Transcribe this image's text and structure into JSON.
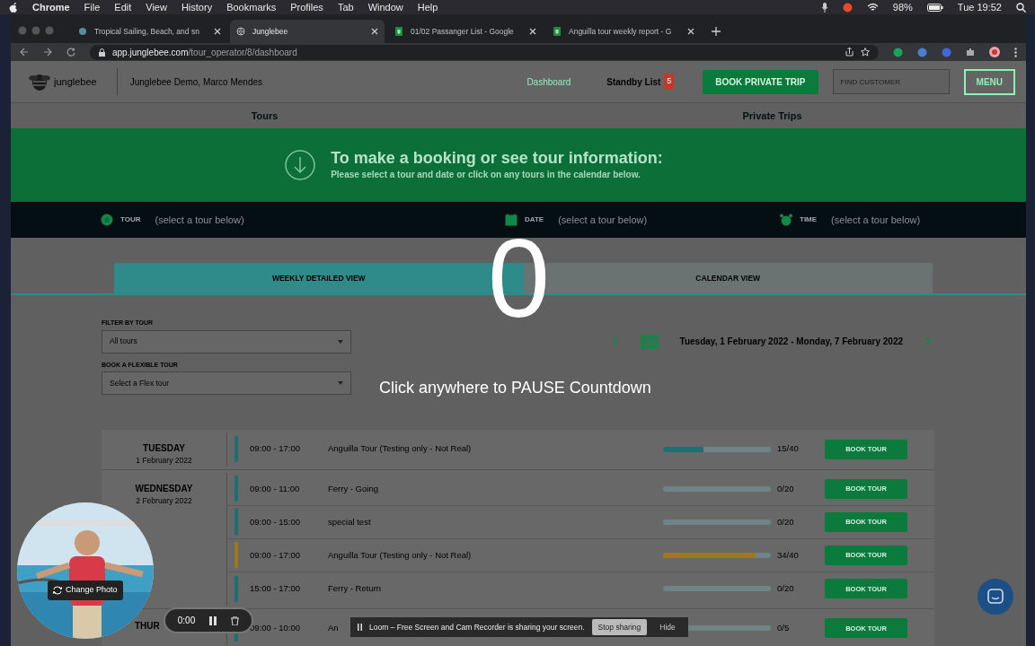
{
  "menu_bar": {
    "app": "Chrome",
    "items": [
      "File",
      "Edit",
      "View",
      "History",
      "Bookmarks",
      "Profiles",
      "Tab",
      "Window",
      "Help"
    ],
    "battery": "98%",
    "clock": "Tue 19:52"
  },
  "browser": {
    "tabs": [
      {
        "title": "Tropical Sailing, Beach, and sn",
        "selected": false
      },
      {
        "title": "Junglebee",
        "selected": true
      },
      {
        "title": "01/02 Passanger List - Google",
        "selected": false
      },
      {
        "title": "Anguilla tour weekly report - G",
        "selected": false
      }
    ],
    "url_domain": "app.junglebee.com",
    "url_path": "/tour_operator/8/dashboard"
  },
  "header": {
    "brand": "junglebee",
    "account": "Junglebee Demo, Marco Mendes",
    "nav_link": "Dashboard",
    "standby": {
      "label": "Standby List",
      "count": "5"
    },
    "book_button": "BOOK PRIVATE TRIP",
    "search": {
      "placeholder": "FIND CUSTOMER"
    },
    "menu_button": "MENU"
  },
  "section_tabs": [
    {
      "label": "Tours"
    },
    {
      "label": "Private Trips"
    }
  ],
  "banner": {
    "title": "To make a booking or see tour information:",
    "subtitle": "Please select a tour and date or click on any tours in the calendar below."
  },
  "selection_bar": [
    {
      "kind": "tour",
      "label": "TOUR",
      "value": "(select a tour below)"
    },
    {
      "kind": "date",
      "label": "DATE",
      "value": "(select a tour below)"
    },
    {
      "kind": "time",
      "label": "TIME",
      "value": "(select a tour below)"
    }
  ],
  "view_toggle": [
    {
      "label": "WEEKLY DETAILED VIEW",
      "selected": true
    },
    {
      "label": "CALENDAR VIEW",
      "selected": false
    }
  ],
  "filters": [
    {
      "label": "FILTER BY TOUR",
      "value": "All tours"
    },
    {
      "label": "BOOK A FLEXIBLE TOUR",
      "value": "Select a Flex tour"
    }
  ],
  "week": {
    "range": "Tuesday, 1 February 2022 - Monday, 7 February 2022"
  },
  "schedule": [
    {
      "day": "TUESDAY",
      "date": "1 February 2022",
      "slots": [
        {
          "time": "09:00 - 17:00",
          "tour": "Anguilla Tour (Testing only - Not Real)",
          "level": 0.375,
          "booked": "15/40",
          "color": "#1b6f75",
          "button": "BOOK TOUR"
        }
      ]
    },
    {
      "day": "WEDNESDAY",
      "date": "2 February 2022",
      "slots": [
        {
          "time": "09:00 - 11:00",
          "tour": "Ferry - Going",
          "level": 0,
          "booked": "0/20",
          "color": "#1b6f75",
          "button": "BOOK TOUR"
        },
        {
          "time": "09:00 - 15:00",
          "tour": "special test",
          "level": 0,
          "booked": "0/20",
          "color": "#1b6f75",
          "button": "BOOK TOUR"
        },
        {
          "time": "09:00 - 17:00",
          "tour": "Anguilla Tour (Testing only - Not Real)",
          "level": 0.85,
          "booked": "34/40",
          "color": "#a0781a",
          "button": "BOOK TOUR"
        },
        {
          "time": "15:00 - 17:00",
          "tour": "Ferry - Return",
          "level": 0,
          "booked": "0/20",
          "color": "#1b6f75",
          "button": "BOOK TOUR"
        }
      ]
    },
    {
      "day": "THUR",
      "slots": [
        {
          "time": "09:00 - 10:00",
          "tour": "An",
          "level": 0,
          "booked": "0/5",
          "color": "#1b6f75",
          "button": "BOOK TOUR"
        }
      ]
    }
  ],
  "countdown": {
    "value": "0",
    "hint": "Click anywhere to PAUSE Countdown"
  },
  "recorder": {
    "photo_button": "Change Photo",
    "timer": "0:00",
    "banner": "Loom – Free Screen and Cam Recorder is sharing your screen.",
    "stop_button": "Stop sharing",
    "hide_button": "Hide"
  }
}
